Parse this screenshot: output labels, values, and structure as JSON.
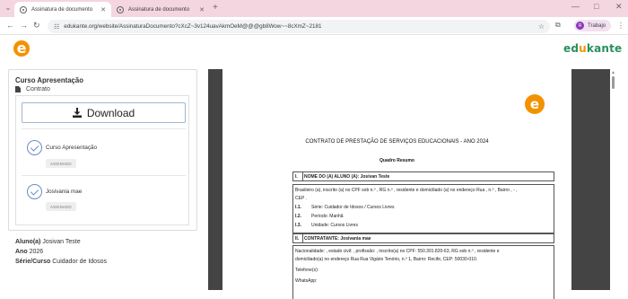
{
  "browser": {
    "tabs": [
      {
        "label": "Assinatura de documento",
        "active": true
      },
      {
        "label": "Assinatura de documento",
        "active": false
      }
    ],
    "url": "edukante.org/website/AssinaturaDocumento?cXcZ~3v124uavAkmOeM@@@gb8Wow~~8cXmZ~2181",
    "profile_label": "Trabajo",
    "profile_initial": "R",
    "icons": {
      "menu": "tab-search-icon",
      "new_tab": "plus-icon",
      "back": "back-arrow-icon",
      "forward": "forward-arrow-icon",
      "reload": "reload-icon",
      "site_info": "tune-icon",
      "bookmark": "star-icon",
      "extensions": "puzzle-icon",
      "more": "kebab-icon"
    },
    "window_controls": [
      "—",
      "□",
      "✕"
    ]
  },
  "header": {
    "logo_letter": "e",
    "brand": {
      "part1": "ed",
      "part2": "u",
      "part3": "kante"
    },
    "brand_colors": {
      "green": "#2a8f5e",
      "orange": "#f39200"
    }
  },
  "left_panel": {
    "course_title": "Curso Apresentação",
    "document_label": "Contrato",
    "download_label": "Download",
    "signers": [
      {
        "name": "Curso Apresentação",
        "status": "ASSINADO"
      },
      {
        "name": "Josivania mae",
        "status": "ASSINADO"
      }
    ]
  },
  "student_info": {
    "aluno_label": "Aluno(a)",
    "aluno_value": "Josivan Teste",
    "ano_label": "Ano",
    "ano_value": "2026",
    "serie_label": "Série/Curso",
    "serie_value": "Cuidador de Idosos"
  },
  "document": {
    "logo_letter": "e",
    "title": "CONTRATO DE PRESTAÇÃO DE SERVIÇOS EDUCACIONAIS - ANO 2024",
    "subtitle": "Quadro Resumo",
    "section1": {
      "num": "I.",
      "label": "NOME DO (A) ALUNO (A): Josivan Teste"
    },
    "line_a": "Brasileiro (a), inscrito (a) no CPF sob n.º , RG n.º , residente e domiciliado (a) no endereço Rua , n.º , Bairro , - ,",
    "line_b": "CEP .",
    "items": [
      {
        "num": "I.1.",
        "text": "Série: Cuidador de Idosos / Cursos Livres"
      },
      {
        "num": "I.2.",
        "text": "Período: Manhã"
      },
      {
        "num": "I.3.",
        "text": "Unidade: Cursos Livres"
      }
    ],
    "section2": {
      "num": "II.",
      "label": "CONTRATANTE: Josivania mae"
    },
    "line_c": "Nacionalidade: , estado civil: , profissão: , inscrito(a) no CPF: 550.301.820-63, RG sob n.º , residente e",
    "line_d": "domiciliado(a) no endereço Rua Rua Vigário Tenório, n.º 1, Bairro: Recife, CEP: 50030-010.",
    "telefone": "Telefone(s):",
    "whatsapp": "WhatsApp:"
  }
}
